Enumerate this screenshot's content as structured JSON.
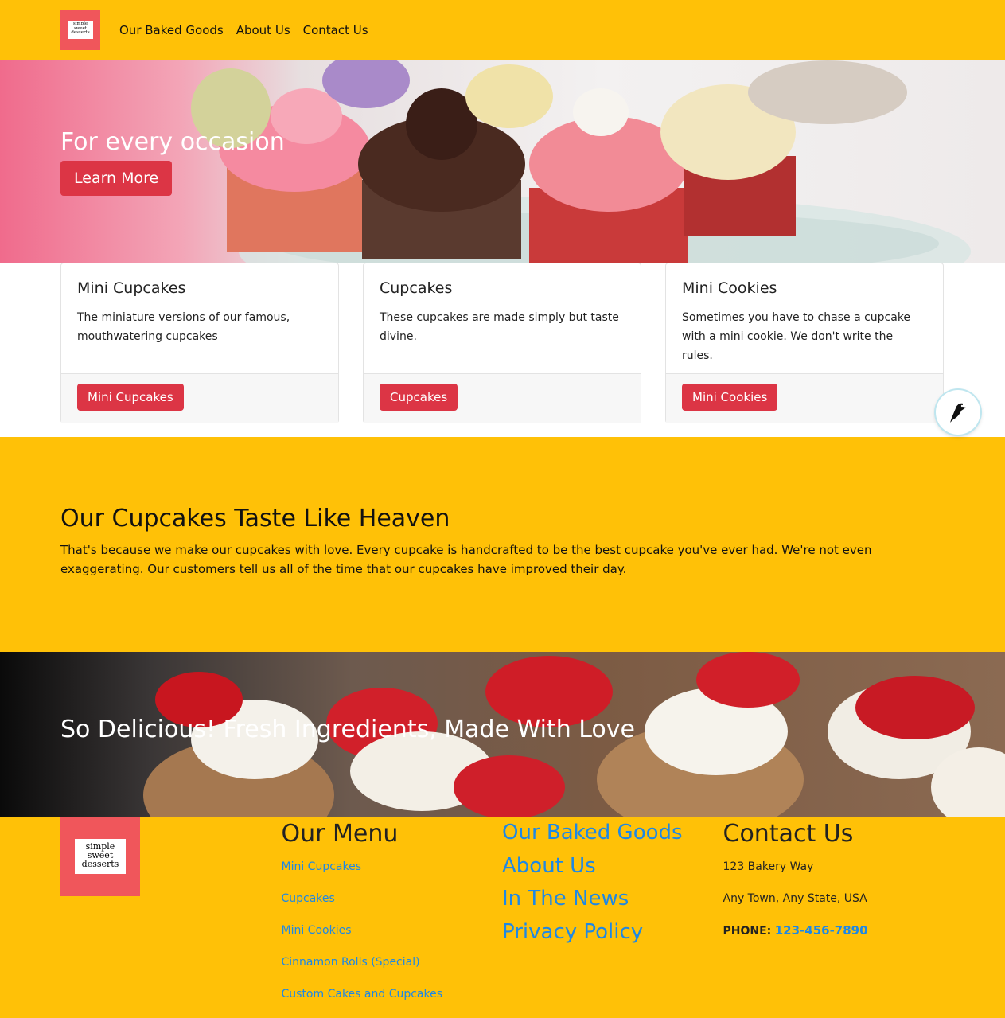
{
  "brand": {
    "logo_text_1": "simple",
    "logo_text_2": "sweet",
    "logo_text_3": "desserts",
    "color": "#f0565b"
  },
  "nav": {
    "items": [
      "Our Baked Goods",
      "About Us",
      "Contact Us"
    ]
  },
  "hero": {
    "title": "For every occasion",
    "button": "Learn More"
  },
  "cards": [
    {
      "title": "Mini Cupcakes",
      "text": "The miniature versions of our famous, mouthwatering cupcakes",
      "button": "Mini Cupcakes"
    },
    {
      "title": "Cupcakes",
      "text": "These cupcakes are made simply but taste divine.",
      "button": "Cupcakes"
    },
    {
      "title": "Mini Cookies",
      "text": "Sometimes you have to chase a cupcake with a mini cookie. We don't write the rules.",
      "button": "Mini Cookies"
    }
  ],
  "heaven": {
    "title": "Our Cupcakes Taste Like Heaven",
    "text": "That's because we make our cupcakes with love. Every cupcake is handcrafted to be the best cupcake you've ever had. We're not even exaggerating. Our customers tell us all of the time that our cupcakes have improved their day."
  },
  "banner": {
    "title": "So Delicious! Fresh Ingredients, Made With Love"
  },
  "footer": {
    "menu_title": "Our Menu",
    "menu": [
      "Mini Cupcakes",
      "Cupcakes",
      "Mini Cookies",
      "Cinnamon Rolls (Special)",
      "Custom Cakes and Cupcakes"
    ],
    "links": [
      "Our Baked Goods",
      "About Us",
      "In The News",
      "Privacy Policy"
    ],
    "contact_title": "Contact Us",
    "address1": "123 Bakery Way",
    "address2": "Any Town, Any State, USA",
    "phone_label": "PHONE:",
    "phone": "123-456-7890"
  },
  "colors": {
    "accent": "#ffc107",
    "button": "#dc3545",
    "link": "#1e88e5"
  },
  "icons": {
    "chat": "bird-icon"
  }
}
